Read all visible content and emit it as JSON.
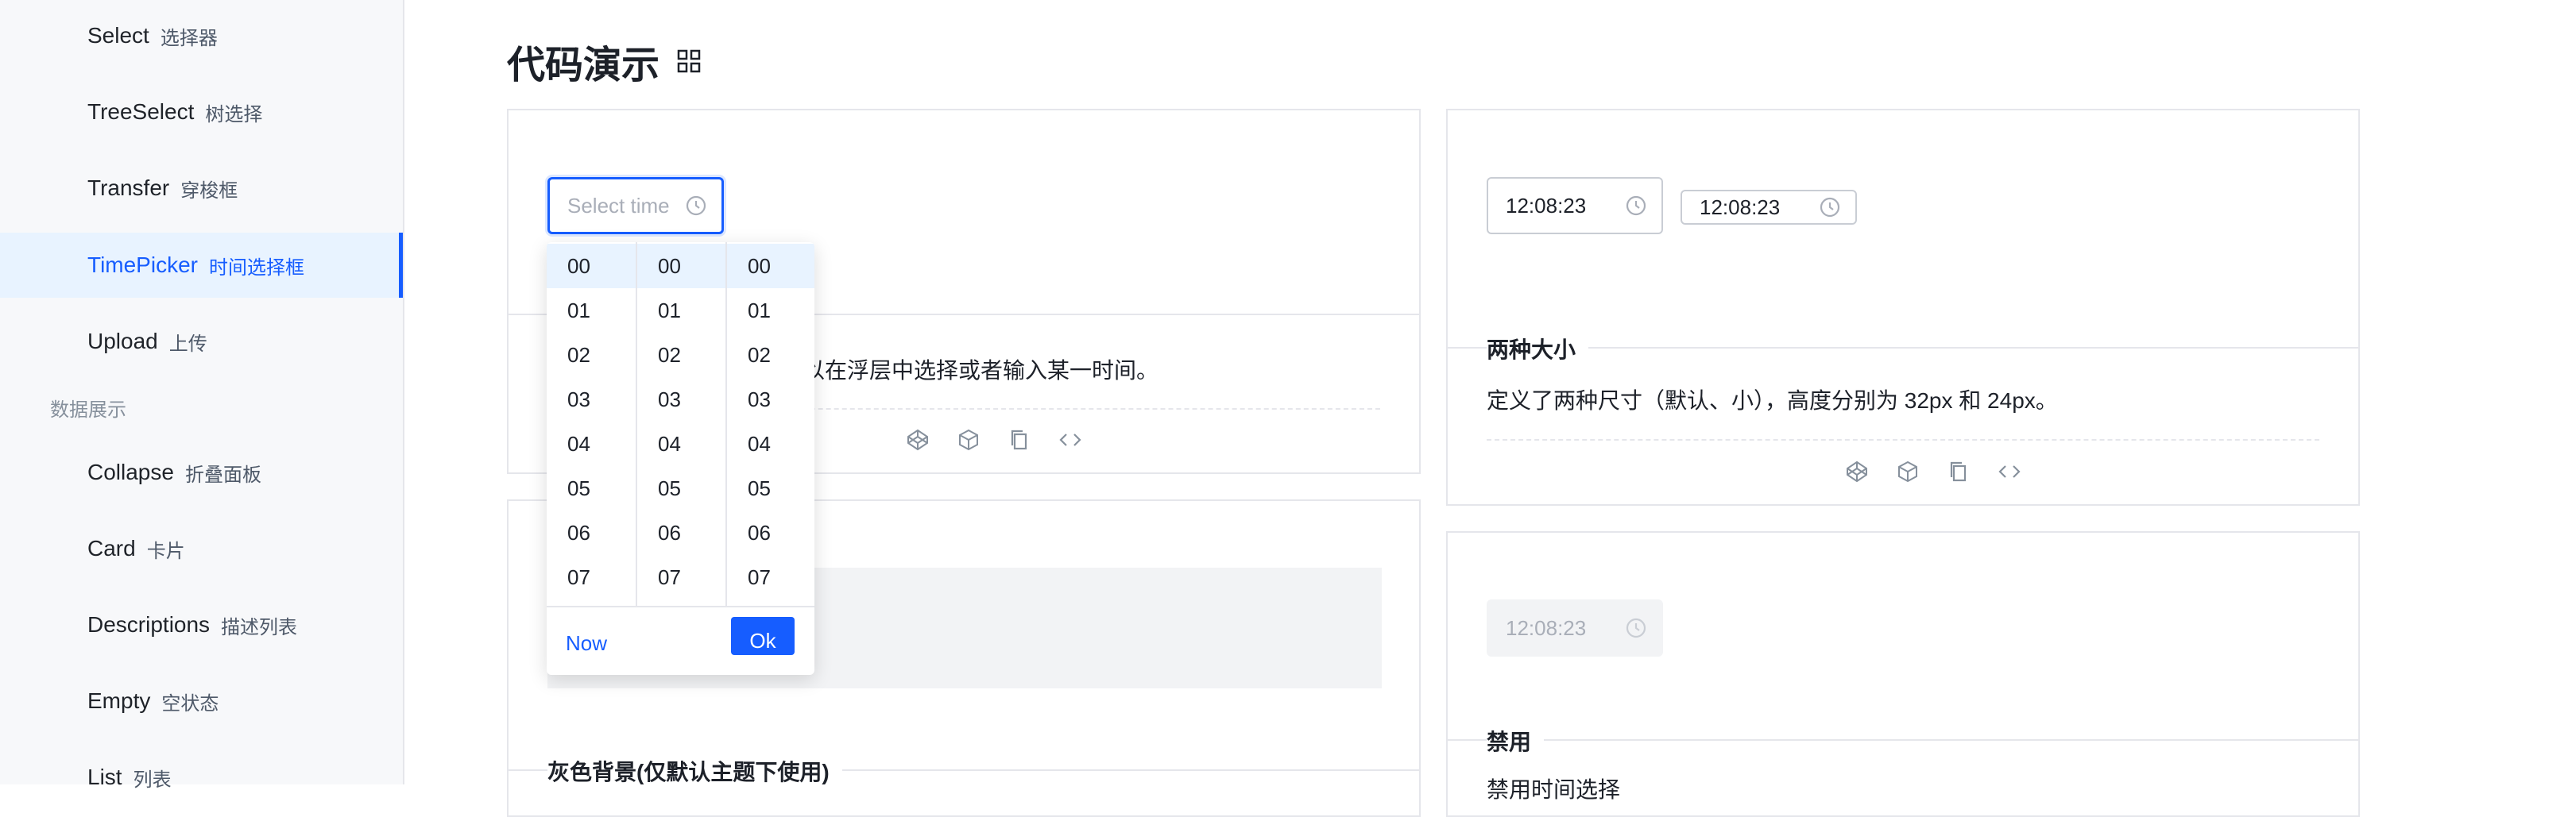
{
  "sidebar": {
    "items": [
      {
        "en": "Select",
        "zh": "选择器"
      },
      {
        "en": "TreeSelect",
        "zh": "树选择"
      },
      {
        "en": "Transfer",
        "zh": "穿梭框"
      },
      {
        "en": "TimePicker",
        "zh": "时间选择框"
      },
      {
        "en": "Upload",
        "zh": "上传"
      },
      {
        "en": "Collapse",
        "zh": "折叠面板"
      },
      {
        "en": "Card",
        "zh": "卡片"
      },
      {
        "en": "Descriptions",
        "zh": "描述列表"
      },
      {
        "en": "Empty",
        "zh": "空状态"
      },
      {
        "en": "List",
        "zh": "列表"
      }
    ],
    "group_data_display": "数据展示",
    "active_item": "TimePicker"
  },
  "main": {
    "title": "代码演示",
    "basic": {
      "placeholder": "Select time",
      "desc_fragment": "以在浮层中选择或者输入某一时间。"
    },
    "sizes": {
      "value_default": "12:08:23",
      "value_small": "12:08:23",
      "title": "两种大小",
      "desc": "定义了两种尺寸（默认、小），高度分别为 32px 和 24px。"
    },
    "gray": {
      "title": "灰色背景(仅默认主题下使用)"
    },
    "disabled": {
      "value": "12:08:23",
      "title": "禁用",
      "desc_partial": "禁用时间选择"
    }
  },
  "picker": {
    "hours": [
      "00",
      "01",
      "02",
      "03",
      "04",
      "05",
      "06",
      "07"
    ],
    "minutes": [
      "00",
      "01",
      "02",
      "03",
      "04",
      "05",
      "06",
      "07"
    ],
    "seconds": [
      "00",
      "01",
      "02",
      "03",
      "04",
      "05",
      "06",
      "07"
    ],
    "now_label": "Now",
    "ok_label": "Ok"
  },
  "colors": {
    "accent": "#165dff",
    "active_bg": "#e8f3ff",
    "sidebar_bg": "#f7f8fa",
    "border": "#e5e6eb"
  }
}
